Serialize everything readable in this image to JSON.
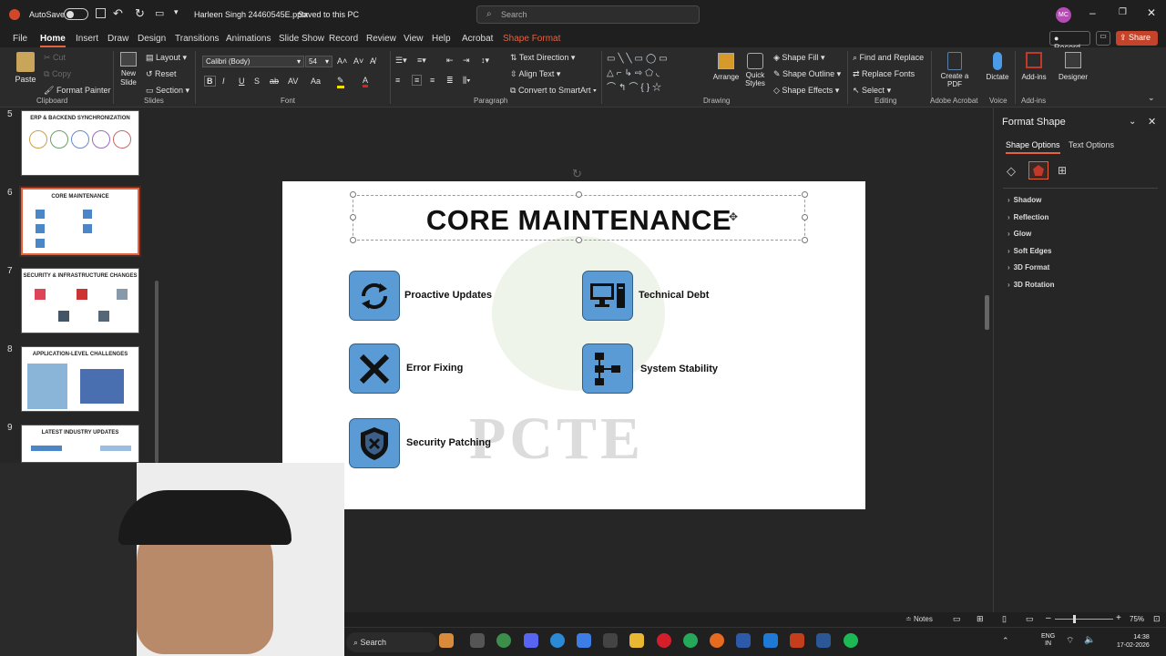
{
  "titlebar": {
    "autosave_label": "AutoSave",
    "file_name": "Harleen Singh 24460545E.pptx",
    "save_status": "Saved to this PC",
    "search_placeholder": "Search",
    "avatar_initials": "MC"
  },
  "tabs": [
    "File",
    "Home",
    "Insert",
    "Draw",
    "Design",
    "Transitions",
    "Animations",
    "Slide Show",
    "Record",
    "Review",
    "View",
    "Help",
    "Acrobat",
    "Shape Format"
  ],
  "active_tab": "Home",
  "tab_actions": {
    "record": "Record",
    "share": "Share"
  },
  "ribbon": {
    "clipboard": {
      "paste": "Paste",
      "cut": "Cut",
      "copy": "Copy",
      "format_painter": "Format Painter",
      "group": "Clipboard"
    },
    "slides": {
      "new_slide": "New Slide",
      "layout": "Layout",
      "reset": "Reset",
      "section": "Section",
      "group": "Slides"
    },
    "font": {
      "name": "Calibri (Body)",
      "size": "54",
      "group": "Font"
    },
    "paragraph": {
      "text_direction": "Text Direction",
      "align_text": "Align Text",
      "convert_smartart": "Convert to SmartArt",
      "group": "Paragraph"
    },
    "drawing": {
      "arrange": "Arrange",
      "quick_styles": "Quick Styles",
      "shape_fill": "Shape Fill",
      "shape_outline": "Shape Outline",
      "shape_effects": "Shape Effects",
      "group": "Drawing"
    },
    "editing": {
      "find_replace": "Find and Replace",
      "replace_fonts": "Replace Fonts",
      "select": "Select",
      "group": "Editing"
    },
    "acrobat": {
      "create_pdf": "Create a PDF",
      "group": "Adobe Acrobat"
    },
    "voice": {
      "dictate": "Dictate",
      "group": "Voice"
    },
    "addins": {
      "addins": "Add-ins",
      "group": "Add-ins"
    },
    "designer": {
      "label": "Designer"
    }
  },
  "thumbnails": [
    {
      "num": "5",
      "title": "ERP & BACKEND SYNCHRONIZATION"
    },
    {
      "num": "6",
      "title": "CORE MAINTENANCE"
    },
    {
      "num": "7",
      "title": "SECURITY & INFRASTRUCTURE CHANGES"
    },
    {
      "num": "8",
      "title": "APPLICATION-LEVEL CHALLENGES"
    },
    {
      "num": "9",
      "title": "LATEST INDUSTRY UPDATES"
    }
  ],
  "slide": {
    "title": "CORE MAINTENANCE",
    "watermark": "PCTE",
    "items": [
      {
        "label": "Proactive Updates",
        "icon": "sync-icon"
      },
      {
        "label": "Technical Debt",
        "icon": "computer-icon"
      },
      {
        "label": "Error Fixing",
        "icon": "x-mark-icon"
      },
      {
        "label": "System Stability",
        "icon": "flowchart-icon"
      },
      {
        "label": "Security Patching",
        "icon": "shield-icon"
      }
    ]
  },
  "format_pane": {
    "title": "Format Shape",
    "tabs": [
      "Shape Options",
      "Text Options"
    ],
    "sections": [
      "Shadow",
      "Reflection",
      "Glow",
      "Soft Edges",
      "3D Format",
      "3D Rotation"
    ]
  },
  "statusbar": {
    "notes": "Notes",
    "zoom": "75%"
  },
  "taskbar": {
    "search": "Search",
    "lang": "ENG",
    "region": "IN",
    "time": "14:38",
    "date": "17-02-2026"
  },
  "colors": {
    "accent": "#e5623f",
    "icon_fill": "#5a9bd5"
  }
}
